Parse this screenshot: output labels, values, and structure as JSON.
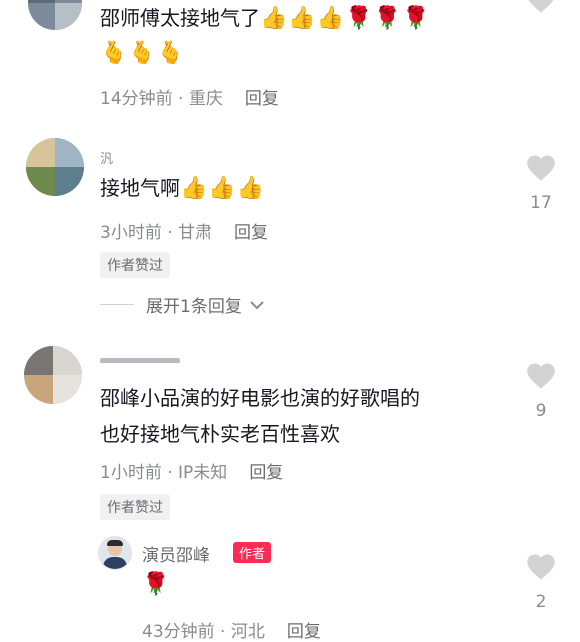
{
  "comments": [
    {
      "text": "邵师傅太接地气了",
      "emoji_line1": "👍👍👍🌹🌹🌹",
      "emoji_line2": "🫰🫰🫰",
      "time": "14分钟前",
      "location": "重庆",
      "reply_label": "回复"
    },
    {
      "username_fragment": "汎",
      "text": "接地气啊",
      "emoji": "👍👍👍",
      "time": "3小时前",
      "location": "甘肃",
      "reply_label": "回复",
      "badge": "作者赞过",
      "likes": "17",
      "expand_label": "展开1条回复"
    },
    {
      "text_line1": "邵峰小品演的好电影也演的好歌唱的",
      "text_line2": "也好接地气朴实老百性喜欢",
      "time": "1小时前",
      "location": "IP未知",
      "reply_label": "回复",
      "badge": "作者赞过",
      "likes": "9",
      "reply": {
        "username": "演员邵峰",
        "author_tag": "作者",
        "emoji": "🌹",
        "time": "43分钟前",
        "location": "河北",
        "reply_label": "回复",
        "likes": "2"
      }
    }
  ],
  "meta_separator": " · ",
  "colors": {
    "accent": "#fe2c55",
    "muted": "#8a8b91",
    "text": "#161823"
  }
}
